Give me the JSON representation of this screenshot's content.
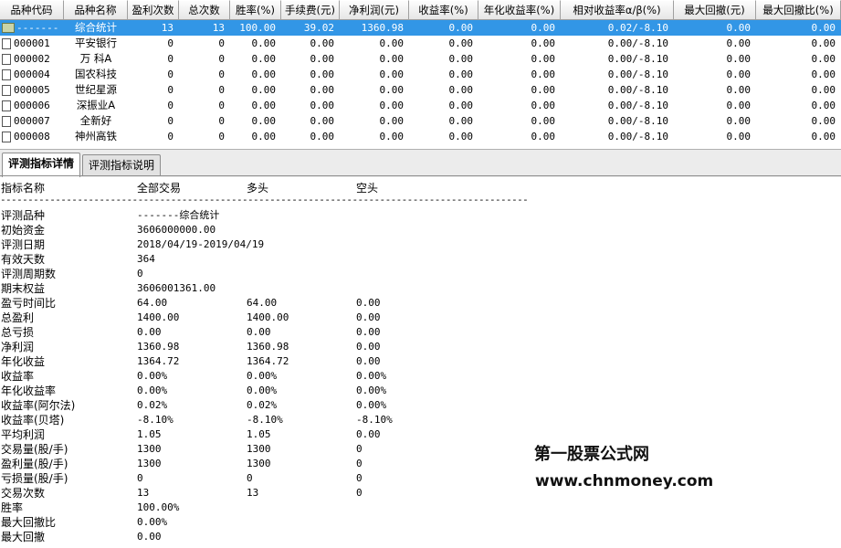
{
  "columns": [
    {
      "label": "品种代码",
      "w": 70
    },
    {
      "label": "品种名称",
      "w": 70
    },
    {
      "label": "盈利次数",
      "w": 56
    },
    {
      "label": "总次数",
      "w": 56
    },
    {
      "label": "胜率(%)",
      "w": 56
    },
    {
      "label": "手续费(元)",
      "w": 64
    },
    {
      "label": "净利润(元)",
      "w": 76
    },
    {
      "label": "收益率(%)",
      "w": 76
    },
    {
      "label": "年化收益率(%)",
      "w": 90
    },
    {
      "label": "相对收益率α/β(%)",
      "w": 124
    },
    {
      "label": "最大回撤(元)",
      "w": 90
    },
    {
      "label": "最大回撤比(%)",
      "w": 93
    }
  ],
  "rows": [
    {
      "selected": true,
      "icon": "summary-icon",
      "code": "-------",
      "name": "综合统计",
      "vals": [
        "13",
        "13",
        "100.00",
        "39.02",
        "1360.98",
        "0.00",
        "0.00",
        "0.02/-8.10",
        "0.00",
        "0.00"
      ]
    },
    {
      "selected": false,
      "icon": "file-icon",
      "code": "000001",
      "name": "平安银行",
      "vals": [
        "0",
        "0",
        "0.00",
        "0.00",
        "0.00",
        "0.00",
        "0.00",
        "0.00/-8.10",
        "0.00",
        "0.00"
      ]
    },
    {
      "selected": false,
      "icon": "file-icon",
      "code": "000002",
      "name": "万 科A",
      "vals": [
        "0",
        "0",
        "0.00",
        "0.00",
        "0.00",
        "0.00",
        "0.00",
        "0.00/-8.10",
        "0.00",
        "0.00"
      ]
    },
    {
      "selected": false,
      "icon": "file-icon",
      "code": "000004",
      "name": "国农科技",
      "vals": [
        "0",
        "0",
        "0.00",
        "0.00",
        "0.00",
        "0.00",
        "0.00",
        "0.00/-8.10",
        "0.00",
        "0.00"
      ]
    },
    {
      "selected": false,
      "icon": "file-icon",
      "code": "000005",
      "name": "世纪星源",
      "vals": [
        "0",
        "0",
        "0.00",
        "0.00",
        "0.00",
        "0.00",
        "0.00",
        "0.00/-8.10",
        "0.00",
        "0.00"
      ]
    },
    {
      "selected": false,
      "icon": "file-icon",
      "code": "000006",
      "name": "深振业A",
      "vals": [
        "0",
        "0",
        "0.00",
        "0.00",
        "0.00",
        "0.00",
        "0.00",
        "0.00/-8.10",
        "0.00",
        "0.00"
      ]
    },
    {
      "selected": false,
      "icon": "file-icon",
      "code": "000007",
      "name": "全新好",
      "vals": [
        "0",
        "0",
        "0.00",
        "0.00",
        "0.00",
        "0.00",
        "0.00",
        "0.00/-8.10",
        "0.00",
        "0.00"
      ]
    },
    {
      "selected": false,
      "icon": "file-icon",
      "code": "000008",
      "name": "神州高铁",
      "vals": [
        "0",
        "0",
        "0.00",
        "0.00",
        "0.00",
        "0.00",
        "0.00",
        "0.00/-8.10",
        "0.00",
        "0.00"
      ]
    }
  ],
  "tabs": [
    {
      "label": "评测指标详情",
      "active": true
    },
    {
      "label": "评测指标说明",
      "active": false
    }
  ],
  "detail": {
    "headers": {
      "name": "指标名称",
      "all": "全部交易",
      "long": "多头",
      "short": "空头"
    },
    "dashes": "------------------------------------------------------------------------------------------------",
    "lines": [
      {
        "label": "评测品种",
        "v1": "-------综合统计",
        "v2": "",
        "v3": ""
      },
      {
        "label": "初始资金",
        "v1": "3606000000.00",
        "v2": "",
        "v3": ""
      },
      {
        "label": "评测日期",
        "v1": "2018/04/19-2019/04/19",
        "v2": "",
        "v3": ""
      },
      {
        "label": "有效天数",
        "v1": "364",
        "v2": "",
        "v3": ""
      },
      {
        "label": "评测周期数",
        "v1": "0",
        "v2": "",
        "v3": ""
      },
      {
        "label": "期末权益",
        "v1": "3606001361.00",
        "v2": "",
        "v3": ""
      },
      {
        "label": "盈亏时间比",
        "v1": "64.00",
        "v2": "64.00",
        "v3": "0.00"
      },
      {
        "label": "总盈利",
        "v1": "1400.00",
        "v2": "1400.00",
        "v3": "0.00"
      },
      {
        "label": "总亏损",
        "v1": "0.00",
        "v2": "0.00",
        "v3": "0.00"
      },
      {
        "label": "净利润",
        "v1": "1360.98",
        "v2": "1360.98",
        "v3": "0.00"
      },
      {
        "label": "年化收益",
        "v1": "1364.72",
        "v2": "1364.72",
        "v3": "0.00"
      },
      {
        "label": "收益率",
        "v1": "0.00%",
        "v2": "0.00%",
        "v3": "0.00%"
      },
      {
        "label": "年化收益率",
        "v1": "0.00%",
        "v2": "0.00%",
        "v3": "0.00%"
      },
      {
        "label": "收益率(阿尔法)",
        "v1": "0.02%",
        "v2": "0.02%",
        "v3": "0.00%"
      },
      {
        "label": "收益率(贝塔)",
        "v1": "-8.10%",
        "v2": "-8.10%",
        "v3": "-8.10%"
      },
      {
        "label": "平均利润",
        "v1": "1.05",
        "v2": "1.05",
        "v3": "0.00"
      },
      {
        "label": "交易量(股/手)",
        "v1": "1300",
        "v2": "1300",
        "v3": "0"
      },
      {
        "label": "盈利量(股/手)",
        "v1": "1300",
        "v2": "1300",
        "v3": "0"
      },
      {
        "label": "亏损量(股/手)",
        "v1": "0",
        "v2": "0",
        "v3": "0"
      },
      {
        "label": "交易次数",
        "v1": "13",
        "v2": "13",
        "v3": "0"
      },
      {
        "label": "胜率",
        "v1": "100.00%",
        "v2": "",
        "v3": ""
      },
      {
        "label": "最大回撤比",
        "v1": "0.00%",
        "v2": "",
        "v3": ""
      },
      {
        "label": "最大回撤",
        "v1": "0.00",
        "v2": "",
        "v3": ""
      }
    ]
  },
  "watermark": {
    "line1": "第一股票公式网",
    "line2": "www.chnmoney.com"
  },
  "colors": {
    "selection": "#3296e6",
    "header_bg": "#e6e6e6"
  }
}
